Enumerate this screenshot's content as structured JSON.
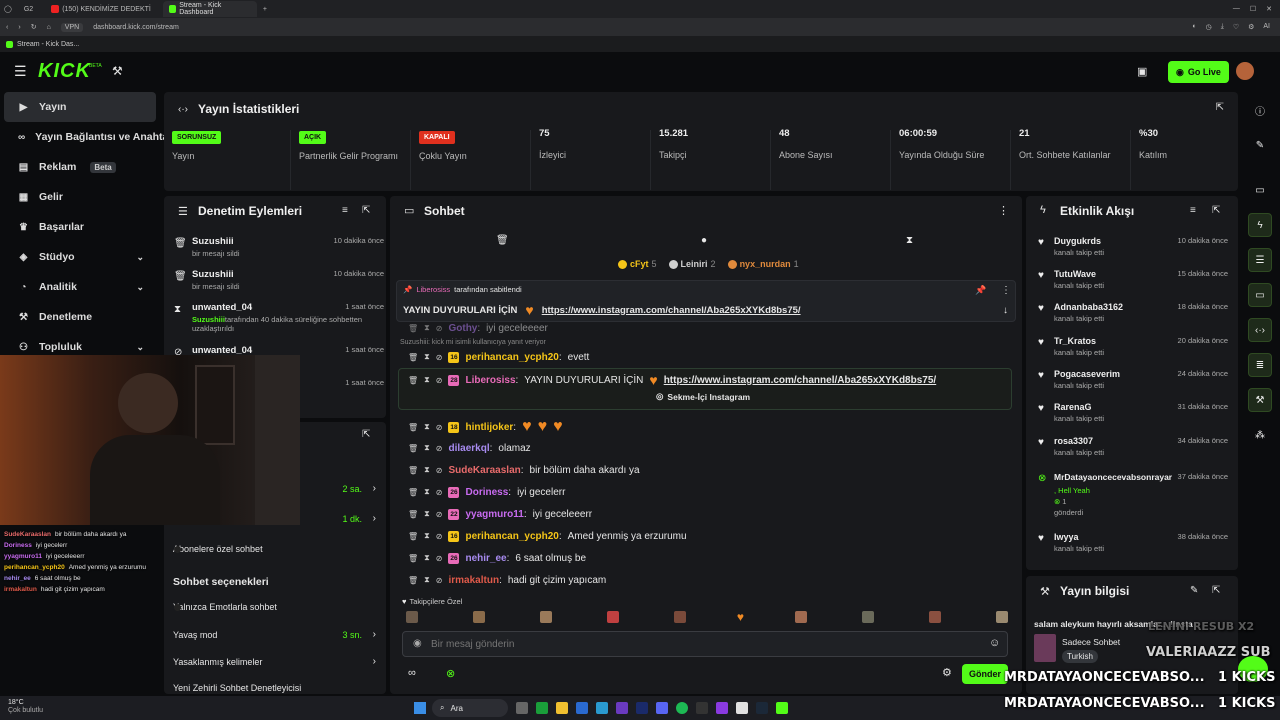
{
  "browser": {
    "tabs": [
      {
        "label": "G2"
      },
      {
        "label": "(150) KENDİMİZE DEDEKTİ"
      },
      {
        "label": "Stream - Kick Dashboard"
      }
    ],
    "new_tab": "+",
    "url": "dashboard.kick.com/stream",
    "vpn": "VPN",
    "bookmark": "Stream - Kick Das...",
    "ai_label": "AI"
  },
  "header": {
    "logo": "KICK",
    "logo_sup": "BETA",
    "go_live": "Go Live"
  },
  "sidebar": {
    "items": [
      {
        "label": "Yayın",
        "icon": "video-icon",
        "active": true
      },
      {
        "label": "Yayın Bağlantısı ve Anahtar",
        "icon": "link-icon"
      },
      {
        "label": "Reklam",
        "icon": "ad-icon",
        "badge": "Beta"
      },
      {
        "label": "Gelir",
        "icon": "money-icon"
      },
      {
        "label": "Başarılar",
        "icon": "trophy-icon"
      },
      {
        "label": "Stüdyo",
        "icon": "studio-icon",
        "chevron": true
      },
      {
        "label": "Analitik",
        "icon": "chart-icon",
        "chevron": true
      },
      {
        "label": "Denetleme",
        "icon": "hammer-icon"
      },
      {
        "label": "Topluluk",
        "icon": "people-icon",
        "chevron": true
      }
    ]
  },
  "stats": {
    "title": "Yayın İstatistikleri",
    "cells": [
      {
        "badge": "SORUNSUZ",
        "badge_color": "#53fc18",
        "label": "Yayın"
      },
      {
        "badge": "AÇIK",
        "badge_color": "#53fc18",
        "label": "Partnerlik Gelir Programı"
      },
      {
        "badge": "KAPALI",
        "badge_color": "#e0301e",
        "label": "Çoklu Yayın"
      },
      {
        "value": "75",
        "label": "İzleyici"
      },
      {
        "value": "15.281",
        "label": "Takipçi"
      },
      {
        "value": "48",
        "label": "Abone Sayısı"
      },
      {
        "value": "06:00:59",
        "label": "Yayında Olduğu Süre"
      },
      {
        "value": "21",
        "label": "Ort. Sohbete Katılanlar"
      },
      {
        "value": "%30",
        "label": "Katılım"
      }
    ]
  },
  "moderation": {
    "title": "Denetim Eylemleri",
    "items": [
      {
        "name": "Suzushiii",
        "sub": "bir mesajı sildi",
        "time": "10 dakika önce"
      },
      {
        "name": "Suzushiii",
        "sub": "bir mesajı sildi",
        "time": "10 dakika önce"
      },
      {
        "name": "unwanted_04",
        "sub_user": "Suzushiii",
        "sub": "tarafından 40 dakika süreliğine sohbetten uzaklaştırıldı",
        "time": "1 saat önce"
      },
      {
        "name": "unwanted_04",
        "sub": "ındırıldı",
        "time": "1 saat önce"
      },
      {
        "name": "",
        "sub": "ıliğine sohbetten",
        "time": "1 saat önce"
      }
    ]
  },
  "chat_settings": {
    "rows": [
      {
        "label": "",
        "value": "2 sa."
      },
      {
        "label": "",
        "value": "1 dk."
      },
      {
        "label": "Abonelere özel sohbet",
        "value": ""
      }
    ],
    "section": "Sohbet seçenekleri",
    "options": [
      {
        "label": "Yalnızca Emotlarla sohbet",
        "value": ""
      },
      {
        "label": "Yavaş mod",
        "value": "3 sn."
      },
      {
        "label": "Yasaklanmış kelimeler",
        "value": ""
      },
      {
        "label": "Yeni Zehirli Sohbet Denetleyicisi",
        "value": ""
      }
    ]
  },
  "chat": {
    "title": "Sohbet",
    "leaders": [
      {
        "name": "cFyt",
        "count": "5",
        "color": "#f5c518"
      },
      {
        "name": "Leiniri",
        "count": "2",
        "color": "#cfcfcf"
      },
      {
        "name": "nyx_nurdan",
        "count": "1",
        "color": "#e08a3c"
      }
    ],
    "pinned": {
      "by_user": "Liberosiss",
      "by_text": "tarafından sabitlendi",
      "text": "YAYIN DUYURULARI İÇİN",
      "link": "https://www.instagram.com/channel/Aba265xXYKd8bs75/"
    },
    "reply_hint": "Suzushiii: kick mi isimli kullanıcıya yanıt veriyor",
    "messages": [
      {
        "user": "Gothy",
        "color": "#b07cf0",
        "text": "iyi geceleeeer",
        "age": ""
      },
      {
        "user": "perihancan_ycph20",
        "color": "#f5c518",
        "text": "evett",
        "age": "16"
      },
      {
        "user": "Liberosiss",
        "color": "#e86bb8",
        "text": "YAYIN DUYURULARI İÇİN",
        "age": "28",
        "link": "https://www.instagram.com/channel/Aba265xXYKd8bs75/",
        "embed": "Sekme-İçi Instagram"
      },
      {
        "user": "hintlijoker",
        "color": "#f5c518",
        "text": "",
        "age": "18"
      },
      {
        "user": "dilaerkql",
        "color": "#a88bf0",
        "text": "olamaz",
        "age": ""
      },
      {
        "user": "SudeKaraaslan",
        "color": "#e86b6b",
        "text": "bir bölüm daha akardı ya",
        "age": ""
      },
      {
        "user": "Doriness",
        "color": "#c86bf0",
        "text": "iyi gecelerr",
        "age": "26"
      },
      {
        "user": "yyagmuro11",
        "color": "#c86bf0",
        "text": "iyi geceleeerr",
        "age": "22"
      },
      {
        "user": "perihancan_ycph20",
        "color": "#f5c518",
        "text": "Amed yenmiş ya erzurumu",
        "age": "16"
      },
      {
        "user": "nehir_ee",
        "color": "#a88bf0",
        "text": "6 saat olmuş be",
        "age": "26"
      },
      {
        "user": "irmakaltun",
        "color": "#e05a4a",
        "text": "hadi git çizim yapıcam",
        "age": ""
      }
    ],
    "followers_only": "Takipçilere Özel",
    "input_placeholder": "Bir mesaj gönderin",
    "send": "Gönder"
  },
  "activity": {
    "title": "Etkinlik Akışı",
    "items": [
      {
        "name": "Duygukrds",
        "sub": "kanalı takip etti",
        "time": "10 dakika önce"
      },
      {
        "name": "TutuWave",
        "sub": "kanalı takip etti",
        "time": "15 dakika önce"
      },
      {
        "name": "Adnanbaba3162",
        "sub": "kanalı takip etti",
        "time": "18 dakika önce"
      },
      {
        "name": "Tr_Kratos",
        "sub": "kanalı takip etti",
        "time": "20 dakika önce"
      },
      {
        "name": "Pogacaseverim",
        "sub": "kanalı takip etti",
        "time": "24 dakika önce"
      },
      {
        "name": "RarenaG",
        "sub": "kanalı takip etti",
        "time": "31 dakika önce"
      },
      {
        "name": "rosa3307",
        "sub": "kanalı takip etti",
        "time": "34 dakika önce"
      },
      {
        "name": "MrDatayaoncecevabsonrayar",
        "sub": "",
        "gift_to": ", Hell Yeah",
        "gift_count": "1",
        "gift_sub": "gönderdi",
        "time": "37 dakika önce"
      },
      {
        "name": "Iwyya",
        "sub": "kanalı takip etti",
        "time": "38 dakika önce"
      }
    ]
  },
  "stream_info": {
    "title": "Yayın bilgisi",
    "stream_title": "salam aleykum hayırlı aksamlar... !insta",
    "category": "Sadece Sohbet",
    "tag": "Turkish"
  },
  "overlay": {
    "ghost": "LENINI    RESUB X2",
    "sub_line": "VALERIAAZZ  SUB",
    "kicks1_user": "MRDATAYAONCECEVABSO...",
    "kicks1_amount": "1 KICKS",
    "kicks2_user": "MRDATAYAONCECEVABSO...",
    "kicks2_amount": "1 KICKS"
  },
  "cam_chat": [
    {
      "user": "SudeKaraaslan",
      "color": "#e86b6b",
      "text": "bir bölüm daha akardı ya"
    },
    {
      "user": "Doriness",
      "color": "#c86bf0",
      "text": "iyi gecelerr"
    },
    {
      "user": "yyagmuro11",
      "color": "#c86bf0",
      "text": "iyi geceleeerr"
    },
    {
      "user": "perihancan_ycph20",
      "color": "#f5c518",
      "text": "Amed yenmiş ya erzurumu"
    },
    {
      "user": "nehir_ee",
      "color": "#a88bf0",
      "text": "6 saat olmuş be"
    },
    {
      "user": "irmakaltun",
      "color": "#e05a4a",
      "text": "hadi git çizim yapıcam"
    }
  ],
  "taskbar": {
    "weather_temp": "18°C",
    "weather_text": "Çok bulutlu",
    "search": "Ara"
  },
  "colors": {
    "accent": "#53fc18",
    "panel": "#18191c",
    "bg": "#0b0c0e"
  }
}
